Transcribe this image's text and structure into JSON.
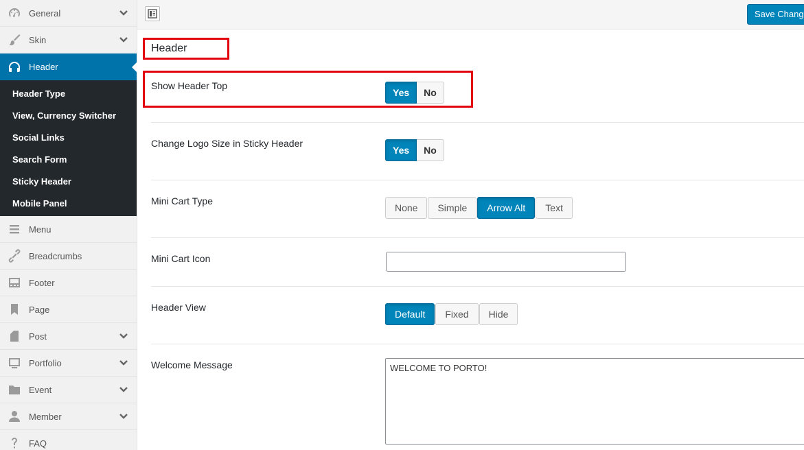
{
  "sidebar": {
    "items_top": [
      {
        "label": "General",
        "icon": "dashboard-icon"
      },
      {
        "label": "Skin",
        "icon": "brush-icon"
      }
    ],
    "active_item": {
      "label": "Header",
      "icon": "headphones-icon"
    },
    "submenu": [
      "Header Type",
      "View, Currency Switcher",
      "Social Links",
      "Search Form",
      "Sticky Header",
      "Mobile Panel"
    ],
    "items_bottom": [
      {
        "label": "Menu",
        "icon": "menu-icon"
      },
      {
        "label": "Breadcrumbs",
        "icon": "link-icon"
      },
      {
        "label": "Footer",
        "icon": "footer-icon"
      },
      {
        "label": "Page",
        "icon": "bookmark-icon"
      },
      {
        "label": "Post",
        "icon": "document-icon"
      },
      {
        "label": "Portfolio",
        "icon": "portfolio-icon"
      },
      {
        "label": "Event",
        "icon": "folder-icon"
      },
      {
        "label": "Member",
        "icon": "user-icon"
      },
      {
        "label": "FAQ",
        "icon": "question-icon"
      }
    ]
  },
  "topbar": {
    "save_label": "Save Changes"
  },
  "main": {
    "section_title": "Header",
    "show_header_top": {
      "label": "Show Header Top",
      "yes": "Yes",
      "no": "No",
      "selected": "Yes"
    },
    "change_logo_size": {
      "label": "Change Logo Size in Sticky Header",
      "yes": "Yes",
      "no": "No",
      "selected": "Yes"
    },
    "mini_cart_type": {
      "label": "Mini Cart Type",
      "options": [
        "None",
        "Simple",
        "Arrow Alt",
        "Text"
      ],
      "selected": "Arrow Alt"
    },
    "mini_cart_icon": {
      "label": "Mini Cart Icon",
      "value": ""
    },
    "header_view": {
      "label": "Header View",
      "options": [
        "Default",
        "Fixed",
        "Hide"
      ],
      "selected": "Default"
    },
    "welcome_message": {
      "label": "Welcome Message",
      "value": "WELCOME TO PORTO!"
    }
  },
  "colors": {
    "accent": "#0085ba",
    "highlight": "#e2000f",
    "sidebar_dark": "#23282d"
  }
}
